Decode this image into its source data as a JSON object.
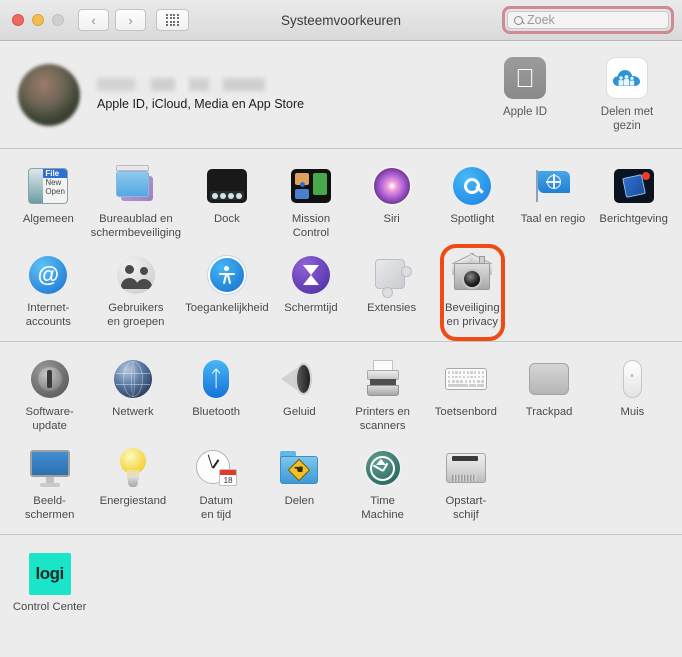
{
  "window": {
    "title": "Systeemvoorkeuren",
    "traffic_lights": [
      "close",
      "minimize",
      "zoom-disabled"
    ],
    "nav": {
      "back": "‹",
      "forward": "›",
      "grid": "show-all-grid"
    }
  },
  "search": {
    "placeholder": "Zoek",
    "value": "",
    "highlight_color": "#cf8a92"
  },
  "account": {
    "name_redacted": true,
    "subtitle": "Apple ID, iCloud, Media en App Store",
    "actions": [
      {
        "label": "Apple ID",
        "icon": "apple-logo-icon"
      },
      {
        "label": "Delen met\ngezin",
        "icon": "family-sharing-cloud-icon"
      }
    ]
  },
  "highlight": {
    "target": "Beveiliging en privacy",
    "color": "#ee4b16"
  },
  "sections": [
    {
      "id": "personal",
      "panes": [
        {
          "label": "Algemeen",
          "icon": "general-icon",
          "art": "algemeen"
        },
        {
          "label": "Bureaublad en\nschermbeveiliging",
          "icon": "desktop-screensaver-icon",
          "art": "bureaublad"
        },
        {
          "label": "Dock",
          "icon": "dock-icon",
          "art": "dock"
        },
        {
          "label": "Mission\nControl",
          "icon": "mission-control-icon",
          "art": "mission"
        },
        {
          "label": "Siri",
          "icon": "siri-icon",
          "art": "siri"
        },
        {
          "label": "Spotlight",
          "icon": "spotlight-icon",
          "art": "spotlight"
        },
        {
          "label": "Taal en regio",
          "icon": "language-region-flag-icon",
          "art": "taal"
        },
        {
          "label": "Berichtgeving",
          "icon": "notifications-icon",
          "art": "bericht"
        },
        {
          "label": "Internet-\naccounts",
          "icon": "internet-accounts-at-icon",
          "art": "internet"
        },
        {
          "label": "Gebruikers\nen groepen",
          "icon": "users-groups-icon",
          "art": "gebruikers"
        },
        {
          "label": "Toegankelijkheid",
          "icon": "accessibility-icon",
          "art": "toegank"
        },
        {
          "label": "Schermtijd",
          "icon": "screen-time-hourglass-icon",
          "art": "schermtijd"
        },
        {
          "label": "Extensies",
          "icon": "extensions-puzzle-icon",
          "art": "extensies"
        },
        {
          "label": "Beveiliging\nen privacy",
          "icon": "security-privacy-house-icon",
          "art": "beveiliging",
          "highlighted": true
        }
      ]
    },
    {
      "id": "hardware",
      "panes": [
        {
          "label": "Software-update",
          "icon": "software-update-gear-icon",
          "art": "softupd"
        },
        {
          "label": "Netwerk",
          "icon": "network-globe-icon",
          "art": "netwerk"
        },
        {
          "label": "Bluetooth",
          "icon": "bluetooth-icon",
          "art": "bt"
        },
        {
          "label": "Geluid",
          "icon": "sound-speaker-icon",
          "art": "geluid"
        },
        {
          "label": "Printers en\nscanners",
          "icon": "printers-scanners-icon",
          "art": "printer"
        },
        {
          "label": "Toetsenbord",
          "icon": "keyboard-icon",
          "art": "kb"
        },
        {
          "label": "Trackpad",
          "icon": "trackpad-icon",
          "art": "trackpad"
        },
        {
          "label": "Muis",
          "icon": "mouse-icon",
          "art": "muis"
        },
        {
          "label": "Beeld-\nschermen",
          "icon": "displays-icon",
          "art": "beeld"
        },
        {
          "label": "Energiestand",
          "icon": "energy-saver-bulb-icon",
          "art": "energie"
        },
        {
          "label": "Datum\nen tijd",
          "icon": "date-time-clock-icon",
          "art": "datum"
        },
        {
          "label": "Delen",
          "icon": "sharing-folder-icon",
          "art": "delen"
        },
        {
          "label": "Time\nMachine",
          "icon": "time-machine-icon",
          "art": "tm"
        },
        {
          "label": "Opstart-\nschijf",
          "icon": "startup-disk-icon",
          "art": "schijf"
        }
      ]
    },
    {
      "id": "third-party",
      "panes": [
        {
          "label": "Control Center",
          "icon": "logi-control-center-icon",
          "art": "logi",
          "icon_text": "logi"
        }
      ]
    }
  ]
}
